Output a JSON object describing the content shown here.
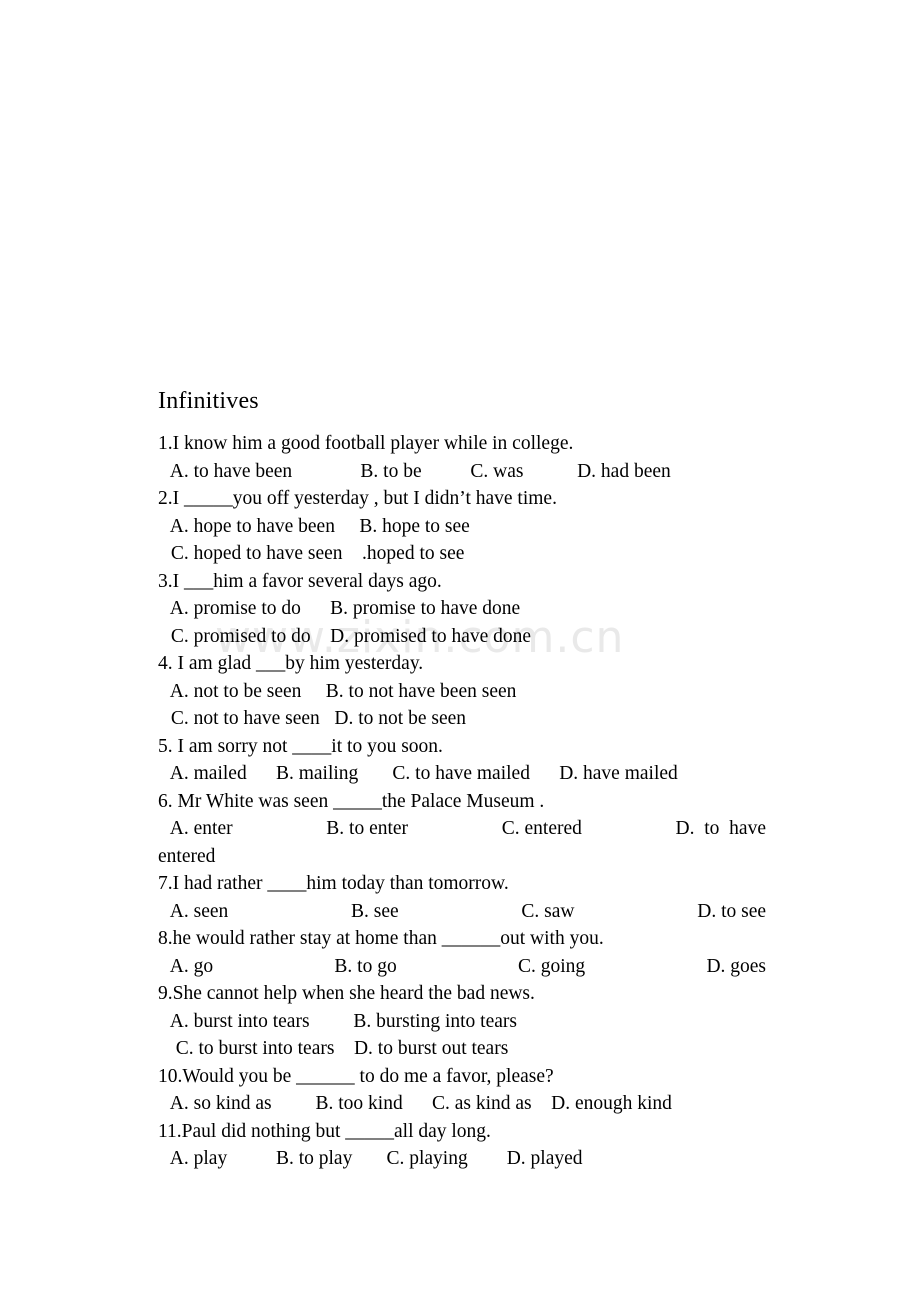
{
  "document": {
    "title": "Infinitives",
    "watermark": "www.zixin.com.cn"
  },
  "questions": [
    {
      "number": "1.",
      "stem": "1.I know him a good football player while in college.",
      "option_lines": [
        " A. to have been              B. to be          C. was           D. had been"
      ]
    },
    {
      "number": "2.",
      "stem": "2.I _____you off yesterday , but I didn’t have time.",
      "option_lines": [
        " A. hope to have been     B. hope to see",
        " C. hoped to have seen    .hoped to see"
      ]
    },
    {
      "number": "3.",
      "stem": "3.I ___him a favor several days ago.",
      "option_lines": [
        " A. promise to do      B. promise to have done",
        " C. promised to do    D. promised to have done"
      ]
    },
    {
      "number": "4.",
      "stem": "4. I am glad ___by him yesterday.",
      "option_lines": [
        " A. not to be seen     B. to not have been seen",
        " C. not to have seen   D. to not be seen"
      ]
    },
    {
      "number": "5.",
      "stem": "5. I am sorry not ____it to you soon.",
      "option_lines": [
        " A. mailed      B. mailing       C. to have mailed      D. have mailed"
      ]
    },
    {
      "number": "6.",
      "stem": "6. Mr White was seen _____the Palace Museum .",
      "option_parts": [
        " A. enter",
        "B. to enter",
        "C. entered",
        "D.  to  have"
      ],
      "option_wrap": "entered"
    },
    {
      "number": "7.",
      "stem": "7.I had rather ____him today than tomorrow.",
      "option_parts": [
        " A. seen",
        "B. see",
        "C. saw",
        "D. to see"
      ]
    },
    {
      "number": "8.",
      "stem": "8.he would rather stay at home than ______out with you.",
      "option_parts": [
        " A. go",
        "B. to go",
        "C. going",
        "D. goes"
      ]
    },
    {
      "number": "9.",
      "stem": "9.She cannot help when she heard the bad news.",
      "option_lines": [
        " A. burst into tears         B. bursting into tears",
        "  C. to burst into tears    D. to burst out tears"
      ]
    },
    {
      "number": "10.",
      "stem": "10.Would you be ______ to do me a favor, please?",
      "option_lines": [
        " A. so kind as         B. too kind      C. as kind as    D. enough kind"
      ]
    },
    {
      "number": "11.",
      "stem": "11.Paul did nothing but _____all day long.",
      "option_lines": [
        " A. play          B. to play       C. playing        D. played"
      ]
    }
  ]
}
